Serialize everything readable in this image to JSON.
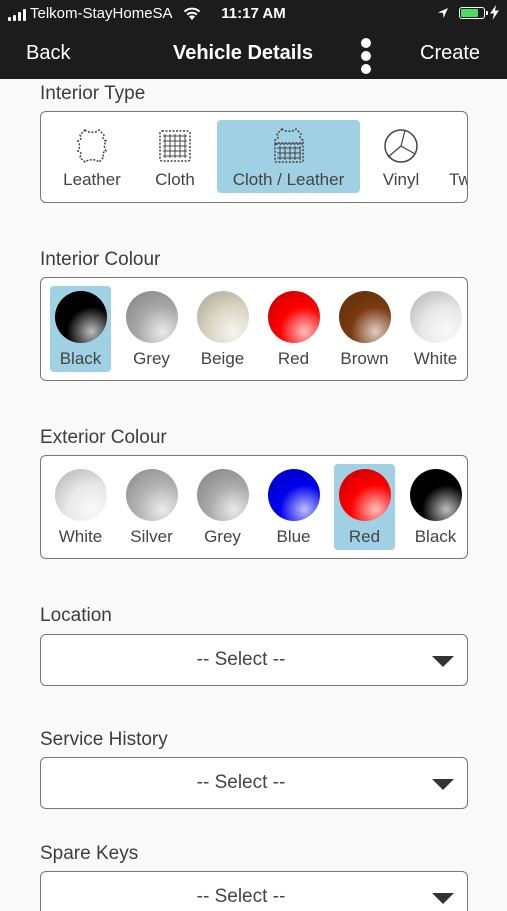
{
  "status_bar": {
    "carrier": "Telkom-StayHomeSA",
    "time": "11:17 AM",
    "battery_level": 0.8
  },
  "nav": {
    "back": "Back",
    "title": "Vehicle Details",
    "create": "Create"
  },
  "interior_type": {
    "label": "Interior Type",
    "options": [
      {
        "label": "Leather",
        "icon": "leather-hide-icon"
      },
      {
        "label": "Cloth",
        "icon": "cloth-icon"
      },
      {
        "label": "Cloth / Leather",
        "icon": "cloth-leather-icon",
        "selected": true
      },
      {
        "label": "Vinyl",
        "icon": "vinyl-icon"
      },
      {
        "label": "Tw",
        "icon": "unknown-icon"
      }
    ]
  },
  "interior_colour": {
    "label": "Interior Colour",
    "options": [
      {
        "label": "Black",
        "color": "#000000",
        "selected": true
      },
      {
        "label": "Grey",
        "color": "#a9a9a9"
      },
      {
        "label": "Beige",
        "color": "#d9d6c2"
      },
      {
        "label": "Red",
        "color": "#ff0000"
      },
      {
        "label": "Brown",
        "color": "#7a3a10"
      },
      {
        "label": "White",
        "color": "#e8e8e8"
      }
    ]
  },
  "exterior_colour": {
    "label": "Exterior Colour",
    "options": [
      {
        "label": "White",
        "color": "#e8e8e8"
      },
      {
        "label": "Silver",
        "color": "#b3b3b3"
      },
      {
        "label": "Grey",
        "color": "#a9a9a9"
      },
      {
        "label": "Blue",
        "color": "#0000ee"
      },
      {
        "label": "Red",
        "color": "#ff0000",
        "selected": true
      },
      {
        "label": "Black",
        "color": "#000000"
      }
    ]
  },
  "location": {
    "label": "Location",
    "value": "-- Select --"
  },
  "service_history": {
    "label": "Service History",
    "value": "-- Select --"
  },
  "spare_keys": {
    "label": "Spare Keys",
    "value": "-- Select --"
  }
}
